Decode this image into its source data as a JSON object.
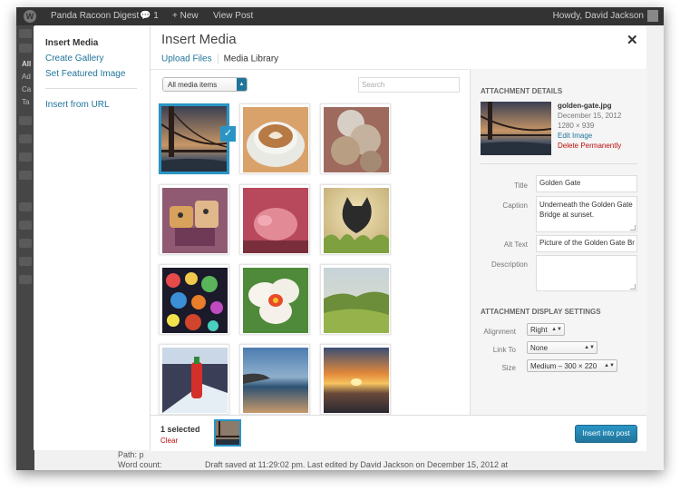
{
  "adminbar": {
    "wp_logo": "W",
    "site_name": "Panda Racoon Digest",
    "comments_count": "1",
    "new_label": "New",
    "view_post": "View Post",
    "howdy": "Howdy, David Jackson"
  },
  "background": {
    "menu_labels": [
      "All",
      "Ad",
      "Ca",
      "Ta"
    ],
    "path_text": "Path: p",
    "word_count_label": "Word count:",
    "draft_status": "Draft saved at 11:29:02 pm. Last edited by David Jackson on December 15, 2012 at"
  },
  "modal": {
    "title": "Insert Media",
    "close_glyph": "✕",
    "menu": {
      "insert_media": "Insert Media",
      "create_gallery": "Create Gallery",
      "set_featured": "Set Featured Image",
      "insert_url": "Insert from URL"
    },
    "routers": {
      "upload": "Upload Files",
      "library": "Media Library"
    },
    "filter": {
      "selected": "All media items"
    },
    "search": {
      "placeholder": "Search"
    },
    "attachments": [
      {
        "name": "golden-gate",
        "selected": true
      },
      {
        "name": "coffee-latte"
      },
      {
        "name": "coins"
      },
      {
        "name": "robot-toys"
      },
      {
        "name": "pig-toy"
      },
      {
        "name": "cat"
      },
      {
        "name": "glass-bubbles"
      },
      {
        "name": "orchid-flower"
      },
      {
        "name": "green-hills"
      },
      {
        "name": "sriracha-fridge"
      },
      {
        "name": "beach-sunset"
      },
      {
        "name": "ocean-sunset"
      }
    ]
  },
  "sidebar": {
    "details_heading": "Attachment Details",
    "filename": "golden-gate.jpg",
    "date": "December 15, 2012",
    "dimensions": "1280 × 939",
    "edit_image": "Edit Image",
    "delete": "Delete Permanently",
    "title_label": "Title",
    "title_value": "Golden Gate",
    "caption_label": "Caption",
    "caption_value": "Underneath the Golden Gate Bridge at sunset.",
    "alt_label": "Alt Text",
    "alt_value": "Picture of the Golden Gate Br",
    "description_label": "Description",
    "description_value": "",
    "display_heading": "Attachment Display Settings",
    "alignment_label": "Alignment",
    "alignment_value": "Right",
    "linkto_label": "Link To",
    "linkto_value": "None",
    "size_label": "Size",
    "size_value": "Medium – 300 × 220"
  },
  "toolbar": {
    "selected_count": "1 selected",
    "clear": "Clear",
    "insert_button": "Insert into post"
  },
  "colors": {
    "accent": "#21759b",
    "selection": "#2a95c5",
    "danger": "#bc0b0b"
  }
}
